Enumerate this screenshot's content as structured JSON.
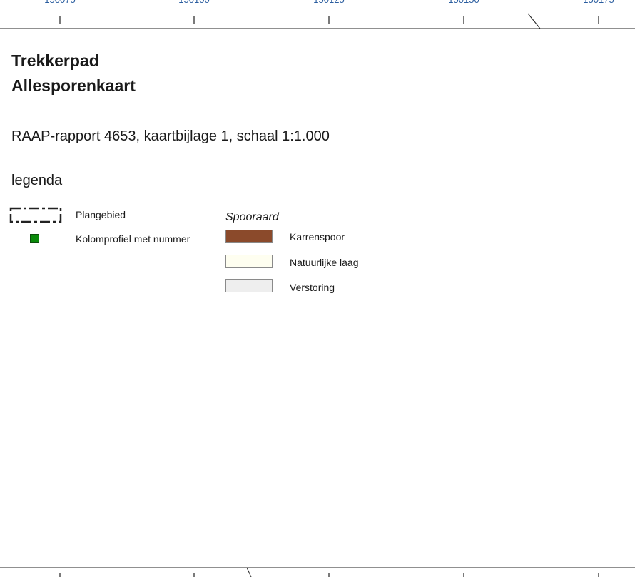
{
  "coords": [
    "150075",
    "150100",
    "150125",
    "150150",
    "150175"
  ],
  "title_line1": "Trekkerpad",
  "title_line2": "Allesporenkaart",
  "subtitle": "RAAP-rapport 4653, kaartbijlage 1, schaal 1:1.000",
  "legend_label": "legenda",
  "legend_left": [
    {
      "label": "Plangebied",
      "icon": "dashed-boundary-icon"
    },
    {
      "label": "Kolomprofiel met nummer",
      "icon": "green-square-icon",
      "color": "#0a8a0a"
    }
  ],
  "spooraard": {
    "heading": "Spooraard",
    "items": [
      {
        "label": "Karrenspoor",
        "color": "#8b4a2b"
      },
      {
        "label": "Natuurlijke laag",
        "color": "#fefef0"
      },
      {
        "label": "Verstoring",
        "color": "#eeeeee"
      }
    ]
  }
}
